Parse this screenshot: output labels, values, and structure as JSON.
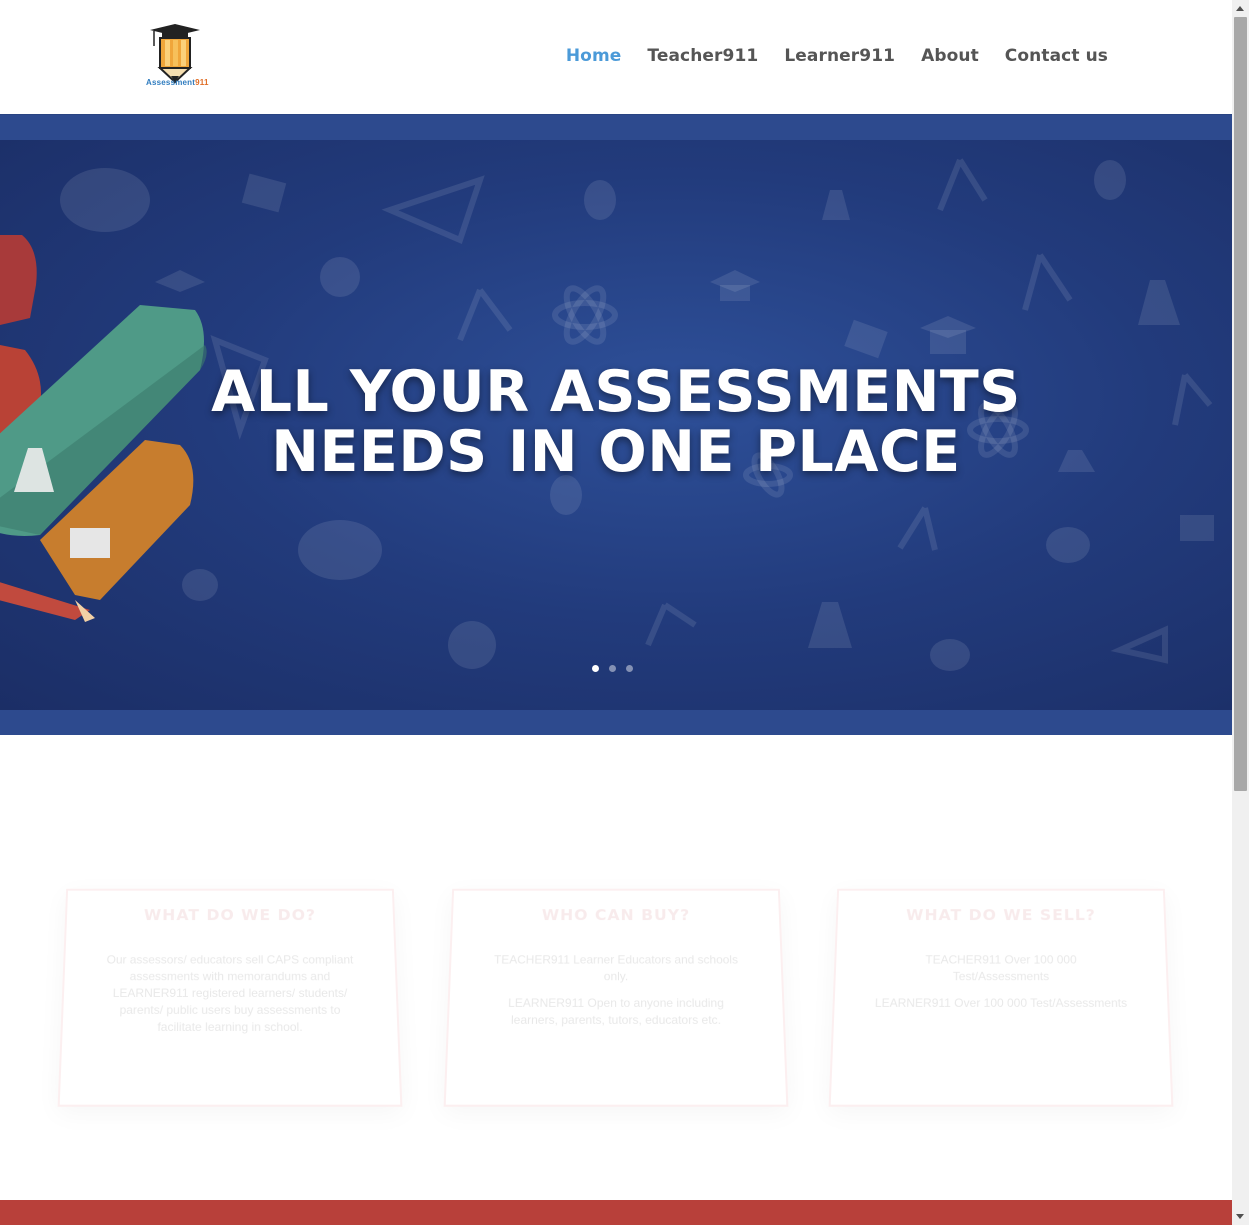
{
  "header": {
    "logo_text_a": "Assessment",
    "logo_text_b": "911",
    "nav": [
      {
        "label": "Home",
        "active": true
      },
      {
        "label": "Teacher911",
        "active": false
      },
      {
        "label": "Learner911",
        "active": false
      },
      {
        "label": "About",
        "active": false
      },
      {
        "label": "Contact us",
        "active": false
      }
    ]
  },
  "hero": {
    "title_line1": "ALL YOUR ASSESSMENTS",
    "title_line2": "NEEDS IN ONE PLACE",
    "slide_count": 3,
    "active_slide": 1
  },
  "cards": [
    {
      "title": "WHAT DO WE DO?",
      "text": "Our assessors/ educators sell CAPS compliant assessments with memorandums and LEARNER911 registered learners/ students/ parents/ public users buy assessments to facilitate learning in school."
    },
    {
      "title": "WHO CAN BUY?",
      "text1": "TEACHER911 Learner Educators and schools only.",
      "text2": "LEARNER911 Open to anyone including learners, parents, tutors, educators etc."
    },
    {
      "title": "WHAT DO WE SELL?",
      "text1": "TEACHER911 Over 100 000 Test/Assessments",
      "text2": "LEARNER911 Over 100 000 Test/Assessments"
    }
  ],
  "colors": {
    "nav_active": "#4b9ad8",
    "hero_bg": "#223b7c",
    "band": "#b8403a"
  }
}
